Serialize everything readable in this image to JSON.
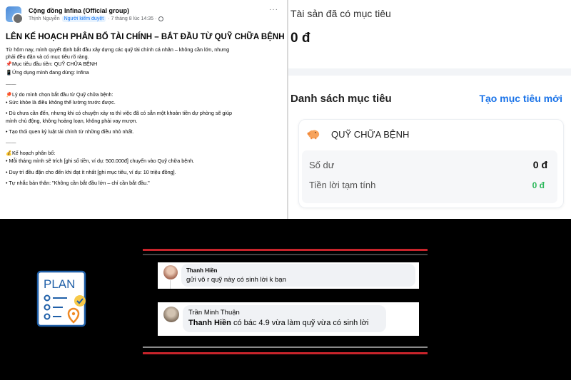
{
  "post": {
    "group_name": "Cộng đồng Infina (Official group)",
    "author": "Thịnh Nguyễn",
    "badge": "Người kiểm duyệt",
    "time": "· 7 tháng 8 lúc 14:35 ·",
    "more": "···",
    "title": "LÊN KẾ HOẠCH PHÂN BỔ TÀI CHÍNH – BẮT ĐẦU TỪ QUỸ CHỮA BỆNH hi",
    "intro_1": "Từ hôm nay, mình quyết định bắt đầu xây dựng các quỹ tài chính cá nhân – không cần lớn, nhưng",
    "intro_2": "phải đều đặn và có mục tiêu rõ ràng.",
    "goal_line": "Mục tiêu đầu tiên: QUỸ CHỮA BỆNH",
    "app_line": "Ứng dụng mình đang dùng: Infina",
    "sep": "——",
    "reason_title": "Lý do mình chọn bắt đầu từ Quỹ chữa bệnh:",
    "reason_1": "• Sức khỏe là điều không thể lường trước được.",
    "reason_2a": "• Dù chưa cần đến, nhưng khi có chuyện xảy ra thì việc đã có sẵn một khoản tiền dự phòng sẽ giúp",
    "reason_2b": "mình chủ động, không hoảng loạn, không phải vay mượn.",
    "reason_3": "• Tạo thói quen kỷ luật tài chính từ những điều nhỏ nhất.",
    "plan_title": "Kế hoạch phân bổ:",
    "plan_1": "• Mỗi tháng mình sẽ trích [ghi số tiền, ví dụ: 500.000đ] chuyển vào Quỹ chữa bệnh.",
    "plan_2": "• Duy trì đều đặn cho đến khi đạt ít nhất [ghi mục tiêu, ví dụ: 10 triệu đồng].",
    "plan_3": "• Tự nhắc bản thân: \"Không cần bắt đầu lớn – chỉ cần bắt đầu.\""
  },
  "app": {
    "assets_label": "Tài sản đã có mục tiêu",
    "assets_value": "0 đ",
    "list_title": "Danh sách mục tiêu",
    "create_link": "Tạo mục tiêu mới",
    "goal": {
      "name": "QUỸ CHỮA BỆNH",
      "balance_label": "Số dư",
      "balance_value": "0 đ",
      "interest_label": "Tiền lời tạm tính",
      "interest_value": "0 đ"
    }
  },
  "comments": [
    {
      "name": "Thanh Hiền",
      "text": "gửi vô r quỹ này có sinh lời k bạn"
    },
    {
      "name": "Trần Minh Thuận",
      "mention": "Thanh Hiền",
      "text": " có bác 4.9 vừa làm quỹ vừa có sinh lời"
    }
  ],
  "plan_icon": {
    "label": "PLAN"
  },
  "colors": {
    "accent_blue": "#1a73e8",
    "interest_green": "#2eb85c",
    "frame_red": "#c8242b",
    "plan_blue": "#1f5fa8",
    "plan_orange": "#f08a24"
  }
}
